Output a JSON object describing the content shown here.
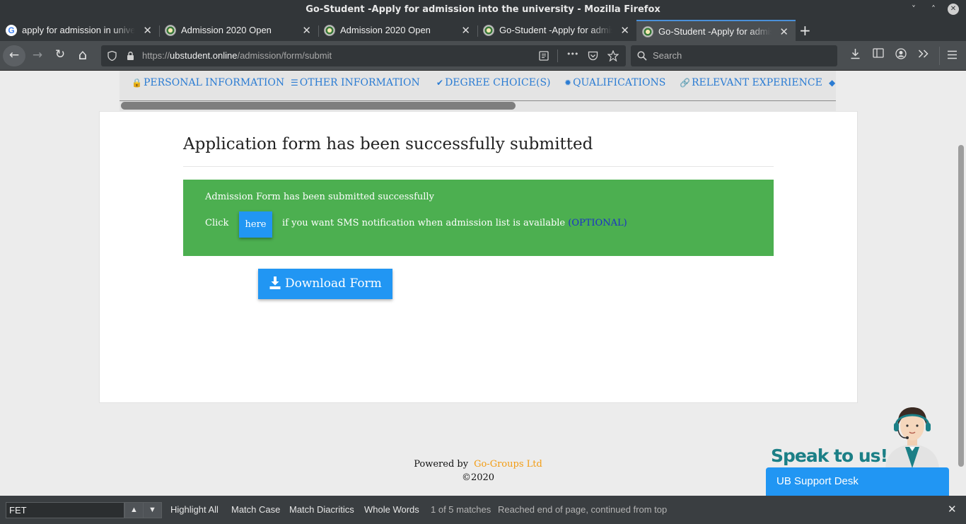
{
  "window": {
    "title": "Go-Student -Apply for admission into the university - Mozilla Firefox",
    "minimize_glyph": "˅",
    "restore_glyph": "˄",
    "close_glyph": "✕"
  },
  "tabs": [
    {
      "title": "apply for admission in university",
      "favicon": "google-g-icon"
    },
    {
      "title": "Admission 2020 Open",
      "favicon": "university-crest-icon"
    },
    {
      "title": "Admission 2020 Open",
      "favicon": "university-crest-icon"
    },
    {
      "title": "Go-Student -Apply for admission",
      "favicon": "university-crest-icon"
    },
    {
      "title": "Go-Student -Apply for admission",
      "favicon": "university-crest-icon",
      "active": true
    }
  ],
  "tab_close_glyph": "✕",
  "new_tab_glyph": "+",
  "google_glyph": "G",
  "nav": {
    "back_glyph": "←",
    "forward_glyph": "→",
    "reload_glyph": "↻",
    "home_glyph": "⌂",
    "url_prefix": "https://",
    "url_domain": "ubstudent.online",
    "url_path": "/admission/form/submit",
    "page_actions_glyph": "•••",
    "search_placeholder": "Search"
  },
  "steps": [
    {
      "icon": "user-lock-icon",
      "glyph": "🔒",
      "label": "PERSONAL INFORMATION"
    },
    {
      "icon": "list-icon",
      "glyph": "☰",
      "label": "OTHER INFORMATION"
    },
    {
      "icon": "check-icon",
      "glyph": "✔",
      "label": "DEGREE CHOICE(S)"
    },
    {
      "icon": "certificate-icon",
      "glyph": "✹",
      "label": "QUALIFICATIONS"
    },
    {
      "icon": "link-icon",
      "glyph": "🔗",
      "label": "RELEVANT EXPERIENCE"
    }
  ],
  "main": {
    "heading": "Application form has been successfully submitted",
    "alert_message": "Admission Form has been submitted successfully",
    "alert_click": "Click",
    "here_button": "here",
    "alert_rest": "if you want SMS notification when admission list is available",
    "alert_optional": "(OPTIONAL)",
    "download_button": "Download Form"
  },
  "footer": {
    "powered_by": "Powered by",
    "company": "Go-Groups Ltd",
    "copyright": "©2020"
  },
  "support": {
    "speak_text": "Speak to us!",
    "desk_label": "UB Support Desk"
  },
  "findbar": {
    "query": "FET",
    "prev_glyph": "▲",
    "next_glyph": "▼",
    "highlight_all": "Highlight All",
    "match_case": "Match Case",
    "match_diacritics": "Match Diacritics",
    "whole_words": "Whole Words",
    "match_count": "1 of 5 matches",
    "status": "Reached end of page, continued from top",
    "close_glyph": "✕"
  },
  "colors": {
    "accent_blue": "#2196f3",
    "success_green": "#4caf50",
    "link_blue": "#2b7cd3",
    "brand_orange": "#f39c12",
    "support_teal": "#1b7f86"
  }
}
